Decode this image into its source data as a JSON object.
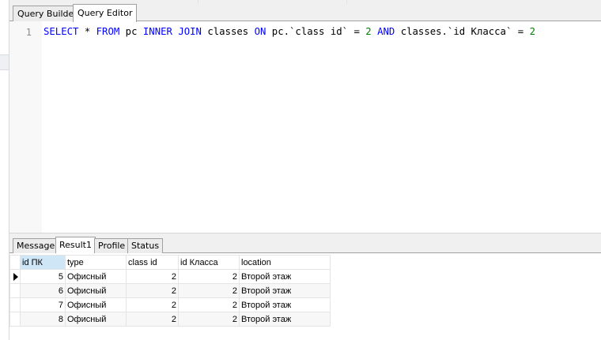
{
  "top_tabs": [
    "Query Builder",
    "Query Editor"
  ],
  "active_top_tab": "Query Editor",
  "editor": {
    "line_number": "1",
    "tokens": [
      {
        "text": "SELECT",
        "kind": "keyword"
      },
      {
        "text": " * ",
        "kind": "plain"
      },
      {
        "text": "FROM",
        "kind": "keyword"
      },
      {
        "text": " pc ",
        "kind": "plain"
      },
      {
        "text": "INNER",
        "kind": "keyword"
      },
      {
        "text": " ",
        "kind": "plain"
      },
      {
        "text": "JOIN",
        "kind": "keyword"
      },
      {
        "text": " classes ",
        "kind": "plain"
      },
      {
        "text": "ON",
        "kind": "keyword"
      },
      {
        "text": " pc.`class id` = ",
        "kind": "plain"
      },
      {
        "text": "2",
        "kind": "number"
      },
      {
        "text": " ",
        "kind": "plain"
      },
      {
        "text": "AND",
        "kind": "keyword"
      },
      {
        "text": " classes.`id Класса` = ",
        "kind": "plain"
      },
      {
        "text": "2",
        "kind": "number"
      }
    ]
  },
  "result_tabs": [
    "Message",
    "Result1",
    "Profile",
    "Status"
  ],
  "active_result_tab": "Result1",
  "grid": {
    "columns": [
      "id ПК",
      "type",
      "class id",
      "id Класса",
      "location"
    ],
    "rows": [
      {
        "current": true,
        "cells": [
          "5",
          "Офисный",
          "2",
          "2",
          "Второй этаж"
        ]
      },
      {
        "current": false,
        "cells": [
          "6",
          "Офисный",
          "2",
          "2",
          "Второй этаж"
        ]
      },
      {
        "current": false,
        "cells": [
          "7",
          "Офисный",
          "2",
          "2",
          "Второй этаж"
        ]
      },
      {
        "current": false,
        "cells": [
          "8",
          "Офисный",
          "2",
          "2",
          "Второй этаж"
        ]
      }
    ]
  },
  "colors": {
    "keyword": "#0000ff",
    "number": "#008000",
    "selected_header": "#cfe6f7"
  }
}
